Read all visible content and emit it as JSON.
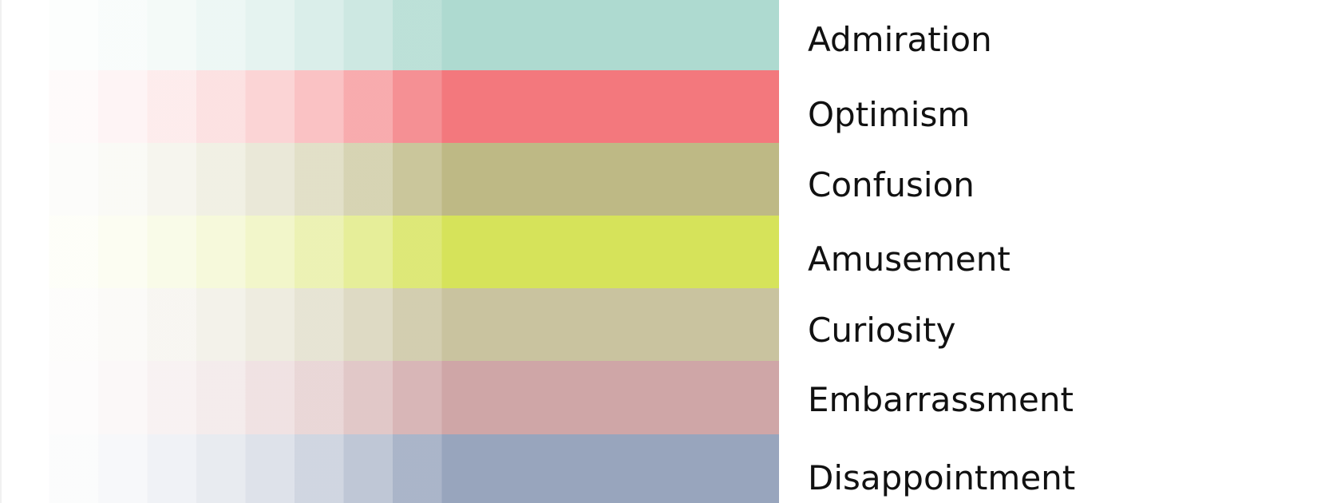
{
  "legend": {
    "items": [
      {
        "label": "Admiration",
        "color": "#aedad0"
      },
      {
        "label": "Optimism",
        "color": "#f3787d"
      },
      {
        "label": "Confusion",
        "color": "#beb985"
      },
      {
        "label": "Amusement",
        "color": "#d6e35a"
      },
      {
        "label": "Curiosity",
        "color": "#c9c39f"
      },
      {
        "label": "Embarrassment",
        "color": "#cfa6a7"
      },
      {
        "label": "Disappointment",
        "color": "#98a5bd"
      }
    ]
  }
}
